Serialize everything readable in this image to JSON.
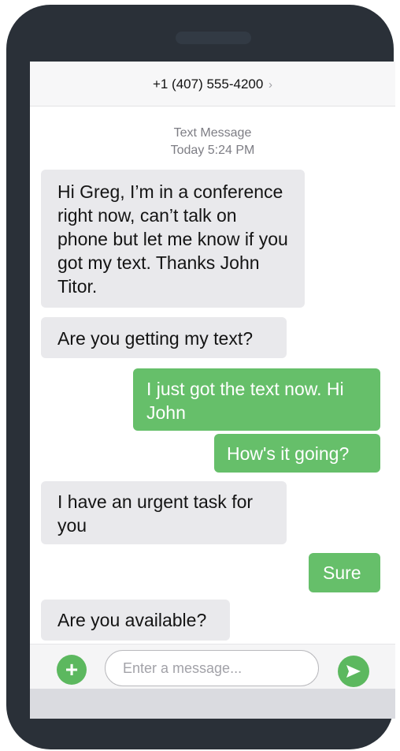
{
  "header": {
    "contact": "+1 (407) 555-4200",
    "chevron": "›"
  },
  "thread": {
    "label": "Text Message",
    "timestamp": "Today 5:24 PM",
    "messages": [
      {
        "from": "them",
        "text": "Hi Greg, I’m in a conference right now, can’t talk on phone but let me know if you got my text. Thanks John Titor."
      },
      {
        "from": "them",
        "text": "Are you getting my text?"
      },
      {
        "from": "me",
        "text": "I just got the text now. Hi John"
      },
      {
        "from": "me",
        "text": "How's it going?"
      },
      {
        "from": "them",
        "text": "I have an urgent task for you"
      },
      {
        "from": "me",
        "text": "Sure"
      },
      {
        "from": "them",
        "text": "Are you available?"
      }
    ]
  },
  "composer": {
    "add_icon": "plus-icon",
    "add_glyph": "+",
    "placeholder": "Enter a message...",
    "value": "",
    "send_icon": "send-icon"
  },
  "colors": {
    "incoming_bubble": "#e9e9ec",
    "outgoing_bubble": "#66bf6a",
    "accent": "#5cb85f",
    "phone_body": "#2a3038"
  }
}
